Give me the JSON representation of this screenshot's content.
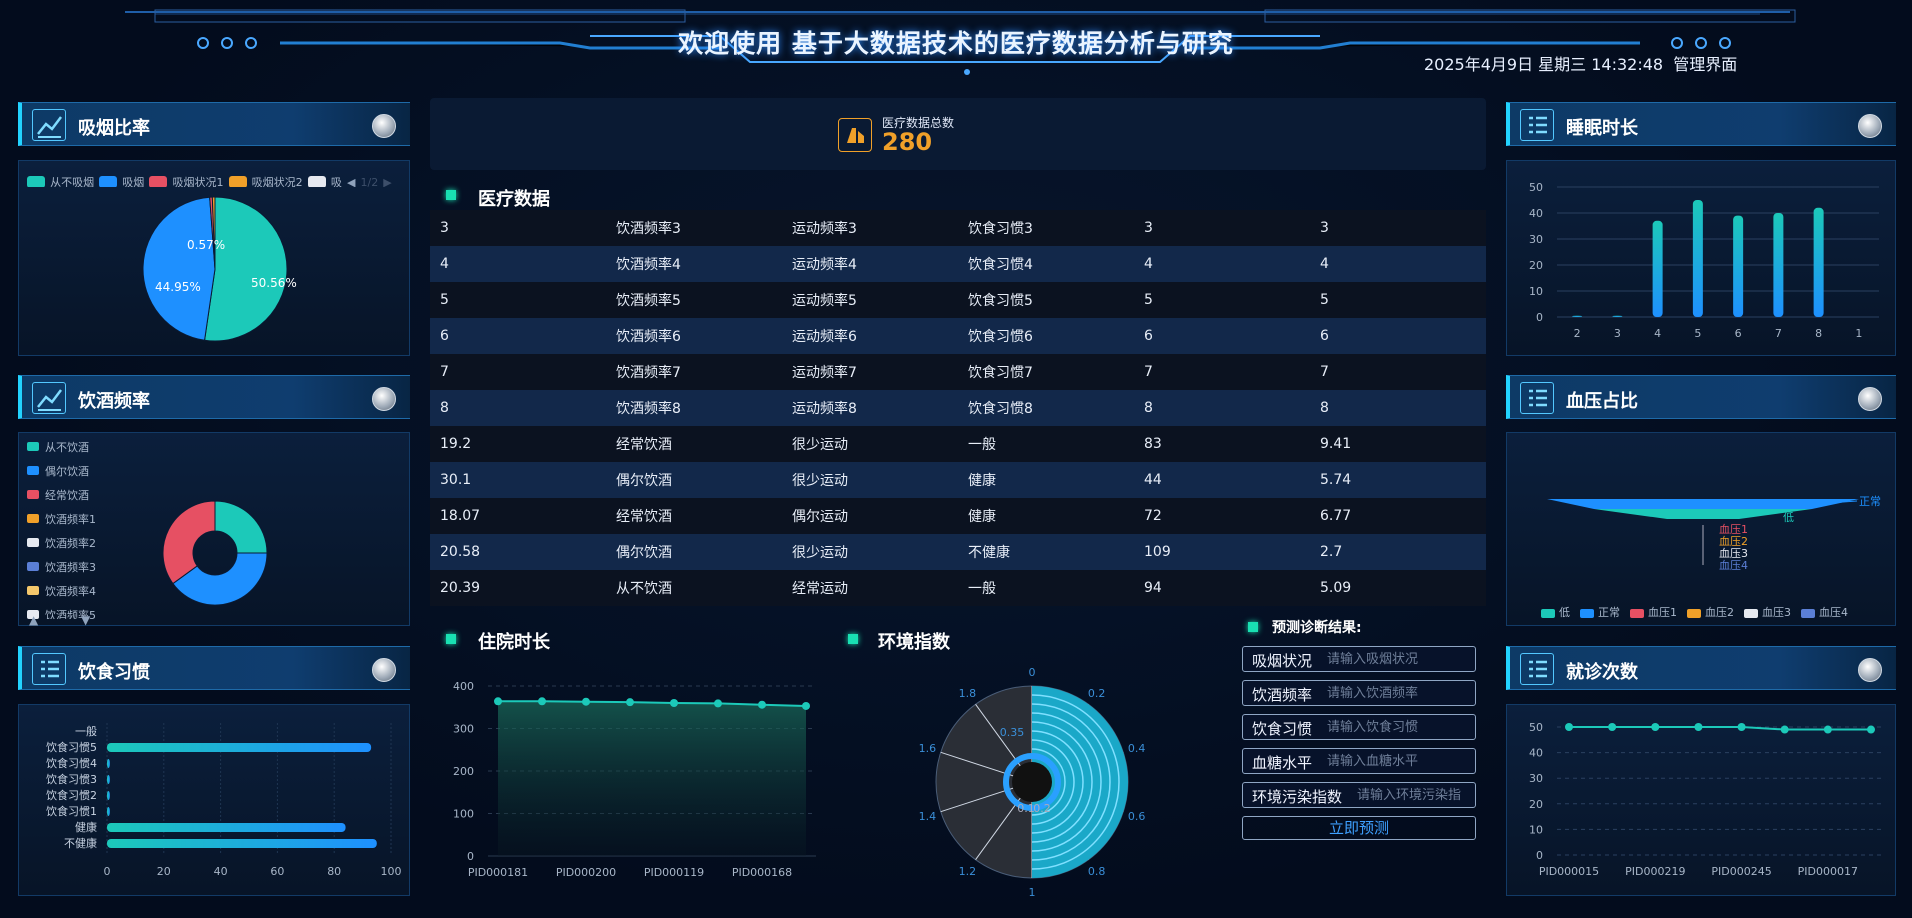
{
  "header": {
    "title": "欢迎使用 基于大数据技术的医疗数据分析与研究",
    "datetime": "2025年4月9日 星期三 14:32:48",
    "admin": "管理界面"
  },
  "colors": {
    "cyan": "#1cc9b9",
    "blue": "#1e90ff",
    "red": "#e65063",
    "orange": "#f0a029",
    "white": "#e6e9f0",
    "slate": "#5b7fd6",
    "yellow": "#f4c76b",
    "accent": "#22d3ff"
  },
  "smoking": {
    "title": "吸烟比率",
    "legend": [
      "从不吸烟",
      "吸烟",
      "吸烟状况1",
      "吸烟状况2",
      "吸"
    ],
    "pager": "1/2",
    "labels": {
      "a": "50.56%",
      "b": "44.95%",
      "c": "0.57%"
    }
  },
  "drinking": {
    "title": "饮酒频率",
    "legend": [
      "从不饮酒",
      "偶尔饮酒",
      "经常饮酒",
      "饮酒频率1",
      "饮酒频率2",
      "饮酒频率3",
      "饮酒频率4",
      "饮酒频率5"
    ]
  },
  "diet": {
    "title": "饮食习惯",
    "categories": [
      "一般",
      "饮食习惯5",
      "饮食习惯4",
      "饮食习惯3",
      "饮食习惯2",
      "饮食习惯1",
      "健康",
      "不健康"
    ],
    "values": [
      0,
      93,
      1,
      1,
      1,
      1,
      84,
      95
    ],
    "xticks": [
      "0",
      "20",
      "40",
      "60",
      "80",
      "100"
    ]
  },
  "total": {
    "label": "医疗数据总数",
    "value": "280"
  },
  "table": {
    "title": "医疗数据",
    "rows": [
      [
        "3",
        "饮酒频率3",
        "运动频率3",
        "饮食习惯3",
        "3",
        "3"
      ],
      [
        "4",
        "饮酒频率4",
        "运动频率4",
        "饮食习惯4",
        "4",
        "4"
      ],
      [
        "5",
        "饮酒频率5",
        "运动频率5",
        "饮食习惯5",
        "5",
        "5"
      ],
      [
        "6",
        "饮酒频率6",
        "运动频率6",
        "饮食习惯6",
        "6",
        "6"
      ],
      [
        "7",
        "饮酒频率7",
        "运动频率7",
        "饮食习惯7",
        "7",
        "7"
      ],
      [
        "8",
        "饮酒频率8",
        "运动频率8",
        "饮食习惯8",
        "8",
        "8"
      ],
      [
        "19.2",
        "经常饮酒",
        "很少运动",
        "一般",
        "83",
        "9.41"
      ],
      [
        "30.1",
        "偶尔饮酒",
        "很少运动",
        "健康",
        "44",
        "5.74"
      ],
      [
        "18.07",
        "经常饮酒",
        "偶尔运动",
        "健康",
        "72",
        "6.77"
      ],
      [
        "20.58",
        "偶尔饮酒",
        "很少运动",
        "不健康",
        "109",
        "2.7"
      ],
      [
        "20.39",
        "从不饮酒",
        "经常运动",
        "一般",
        "94",
        "5.09"
      ]
    ]
  },
  "hospital": {
    "title": "住院时长",
    "yticks": [
      "0",
      "100",
      "200",
      "300",
      "400"
    ],
    "xlabels": [
      "PID000181",
      "PID000200",
      "PID000119",
      "PID000168"
    ]
  },
  "env": {
    "title": "环境指数",
    "angle_ticks": [
      "0",
      "0.2",
      "0.4",
      "0.6",
      "0.8",
      "1",
      "1.2",
      "1.4",
      "1.6",
      "1.8"
    ],
    "inner_labels": [
      "0.35",
      "0.1",
      "0.2"
    ]
  },
  "predict": {
    "title": "预测诊断结果:",
    "fields": [
      {
        "label": "吸烟状况",
        "placeholder": "请输入吸烟状况"
      },
      {
        "label": "饮酒频率",
        "placeholder": "请输入饮酒频率"
      },
      {
        "label": "饮食习惯",
        "placeholder": "请输入饮食习惯"
      },
      {
        "label": "血糖水平",
        "placeholder": "请输入血糖水平"
      },
      {
        "label": "环境污染指数",
        "placeholder": "请输入环境污染指"
      }
    ],
    "button": "立即预测"
  },
  "sleep": {
    "title": "睡眠时长",
    "yticks": [
      "0",
      "10",
      "20",
      "30",
      "40",
      "50"
    ],
    "xlabels": [
      "2",
      "3",
      "4",
      "5",
      "6",
      "7",
      "8",
      "1"
    ],
    "values": [
      0.5,
      0.5,
      37,
      45,
      39,
      40,
      42,
      0
    ]
  },
  "bp": {
    "title": "血压占比",
    "labels": [
      "正常",
      "低",
      "血压1",
      "血压2",
      "血压3",
      "血压4"
    ],
    "legend": [
      "低",
      "正常",
      "血压1",
      "血压2",
      "血压3",
      "血压4"
    ]
  },
  "visits": {
    "title": "就诊次数",
    "yticks": [
      "0",
      "10",
      "20",
      "30",
      "40",
      "50"
    ],
    "xlabels": [
      "PID000015",
      "PID000219",
      "PID000245",
      "PID000017"
    ]
  },
  "chart_data": [
    {
      "type": "pie",
      "title": "吸烟比率",
      "categories": [
        "从不吸烟",
        "吸烟",
        "吸烟状况1",
        "吸烟状况2"
      ],
      "values": [
        50.56,
        44.95,
        0.57,
        0.57
      ]
    },
    {
      "type": "pie",
      "title": "饮酒频率",
      "categories": [
        "从不饮酒",
        "偶尔饮酒",
        "经常饮酒"
      ],
      "values": [
        25,
        40,
        35
      ]
    },
    {
      "type": "bar",
      "title": "饮食习惯",
      "categories": [
        "一般",
        "饮食习惯5",
        "饮食习惯4",
        "饮食习惯3",
        "饮食习惯2",
        "饮食习惯1",
        "健康",
        "不健康"
      ],
      "values": [
        0,
        93,
        1,
        1,
        1,
        1,
        84,
        95
      ],
      "xlim": [
        0,
        100
      ]
    },
    {
      "type": "area",
      "title": "住院时长",
      "x": [
        "PID000181",
        "",
        "PID000200",
        "",
        "PID000119",
        "",
        "PID000168",
        ""
      ],
      "values": [
        364,
        364,
        363,
        362,
        360,
        359,
        356,
        353
      ],
      "ylim": [
        0,
        400
      ]
    },
    {
      "type": "bar",
      "title": "睡眠时长",
      "categories": [
        "2",
        "3",
        "4",
        "5",
        "6",
        "7",
        "8",
        "1"
      ],
      "values": [
        0.5,
        0.5,
        37,
        45,
        39,
        40,
        42,
        0
      ],
      "ylim": [
        0,
        50
      ]
    },
    {
      "type": "line",
      "title": "就诊次数",
      "x": [
        "PID000015",
        "",
        "PID000219",
        "",
        "PID000245",
        "",
        "PID000017",
        ""
      ],
      "values": [
        50,
        50,
        50,
        50,
        50,
        49,
        49,
        49
      ],
      "ylim": [
        0,
        50
      ]
    }
  ]
}
